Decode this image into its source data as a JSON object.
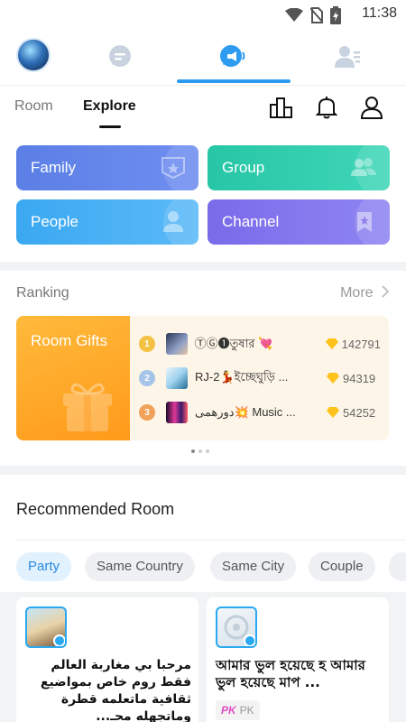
{
  "status_bar": {
    "time": "11:38"
  },
  "sub_nav": {
    "room_label": "Room",
    "explore_label": "Explore"
  },
  "categories": [
    {
      "label": "Family"
    },
    {
      "label": "Group"
    },
    {
      "label": "People"
    },
    {
      "label": "Channel"
    }
  ],
  "ranking": {
    "title": "Ranking",
    "more_label": "More",
    "gifts_label": "Room Gifts",
    "rows": [
      {
        "rank": "1",
        "name": "ⓉⒼ❶তুষার 💘",
        "value": "142791"
      },
      {
        "rank": "2",
        "name": "RJ-2💃ইচ্ছেঘুড়ি ...",
        "value": "94319"
      },
      {
        "rank": "3",
        "name": "دورهمی💥 Music ...",
        "value": "54252"
      }
    ]
  },
  "recommended": {
    "title": "Recommended Room",
    "chips": [
      "Party",
      "Same Country",
      "Same City",
      "Couple"
    ],
    "rooms": [
      {
        "desc": "مرحبا بي مغاربة العالم فقط روم خاص بمواضيع ثقافية ماتعلمه قطرة وماتجهله محـ..."
      },
      {
        "desc": "আমার ভুল হয়েছে হ আমার ভুল হয়েছে মাপ ...",
        "badge": "PK"
      }
    ]
  },
  "colors": {
    "accent": "#2c9bf0",
    "family": "#5b7fe6",
    "group": "#27c6a6",
    "people": "#3aa8f1",
    "channel": "#7a6bea",
    "gifts": "#ff9a1a"
  }
}
